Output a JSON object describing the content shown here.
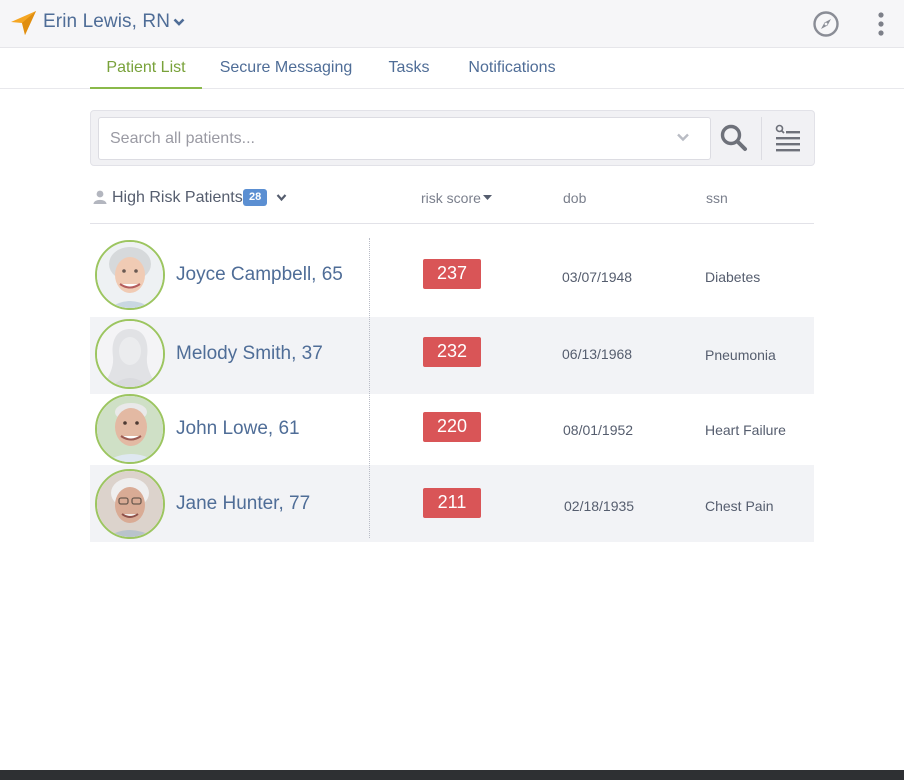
{
  "header": {
    "user_name": "Erin Lewis, RN",
    "brand_icon": "navigation-arrow-icon",
    "compass_icon": "compass-icon",
    "menu_icon": "kebab-menu-icon",
    "brand_color": "#f5a623"
  },
  "tabs": [
    {
      "label": "Patient List",
      "active": true
    },
    {
      "label": "Secure Messaging",
      "active": false
    },
    {
      "label": "Tasks",
      "active": false
    },
    {
      "label": "Notifications",
      "active": false
    }
  ],
  "search": {
    "placeholder": "Search all patients...",
    "value": ""
  },
  "list": {
    "title": "High Risk Patients",
    "count": "28",
    "columns": [
      "risk score",
      "dob",
      "ssn"
    ],
    "sort_column": "risk score",
    "score_color": "#d95557",
    "avatar_ring_color": "#9cc560"
  },
  "patients": [
    {
      "name": "Joyce Campbell, 65",
      "risk_score": "237",
      "dob": "03/07/1948",
      "condition": "Diabetes"
    },
    {
      "name": "Melody Smith, 37",
      "risk_score": "232",
      "dob": "06/13/1968",
      "condition": "Pneumonia"
    },
    {
      "name": "John Lowe, 61",
      "risk_score": "220",
      "dob": "08/01/1952",
      "condition": "Heart Failure"
    },
    {
      "name": "Jane Hunter, 77",
      "risk_score": "211",
      "dob": "02/18/1935",
      "condition": "Chest Pain"
    }
  ]
}
